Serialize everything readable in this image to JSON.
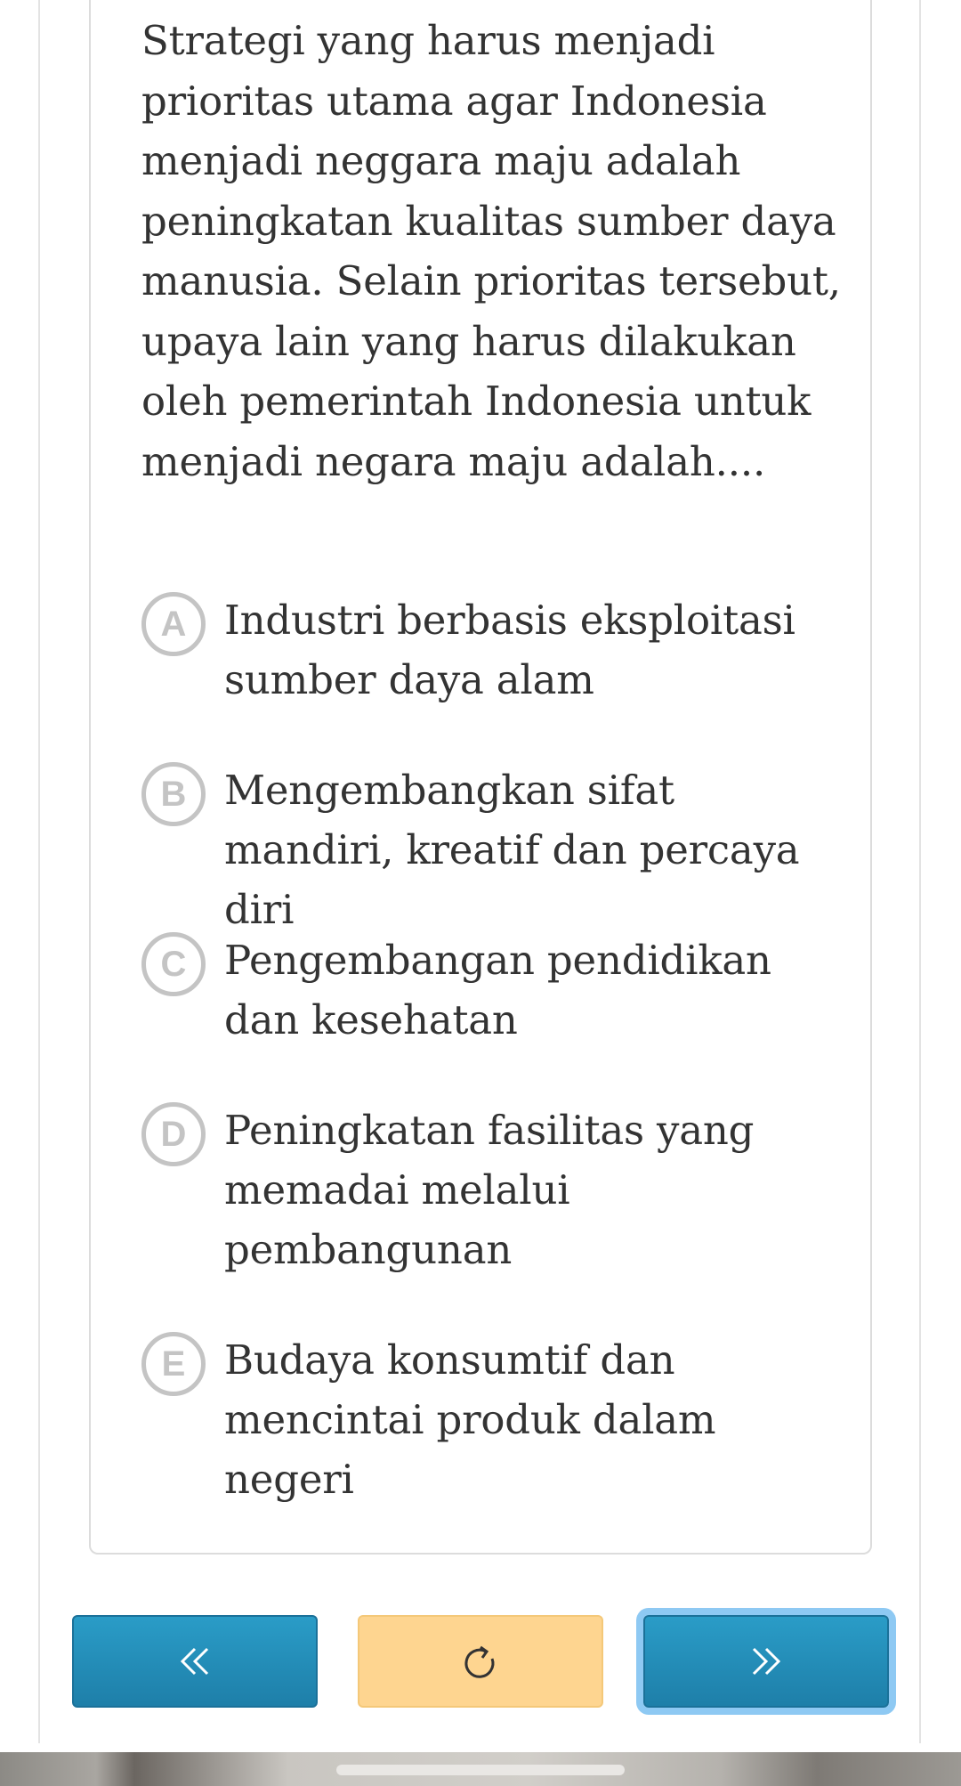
{
  "question": {
    "text": "Strategi yang harus menjadi prioritas utama agar Indonesia menjadi neggara maju adalah peningkatan kualitas sumber daya manusia. Selain prioritas tersebut, upaya lain yang harus dilakukan oleh pemerintah Indonesia untuk menjadi negara maju adalah...."
  },
  "options": [
    {
      "letter": "A",
      "text": "Industri berbasis eksploitasi sumber daya alam"
    },
    {
      "letter": "B",
      "text": "Mengembangkan sifat mandiri, kreatif dan percaya diri"
    },
    {
      "letter": "C",
      "text": "Pengembangan pendidikan dan kesehatan"
    },
    {
      "letter": "D",
      "text": "Peningkatan fasilitas yang memadai melalui pembangunan"
    },
    {
      "letter": "E",
      "text": "Budaya konsumtif dan mencintai produk dalam negeri"
    }
  ],
  "navigation": {
    "previous_icon": "double-chevron-left-icon",
    "reset_icon": "refresh-icon",
    "next_icon": "double-chevron-right-icon"
  },
  "colors": {
    "nav_blue": "#2a9cc7",
    "reset_yellow": "#fed590",
    "focus_ring": "#8ec9f3",
    "option_badge": "#c4c4c4"
  }
}
